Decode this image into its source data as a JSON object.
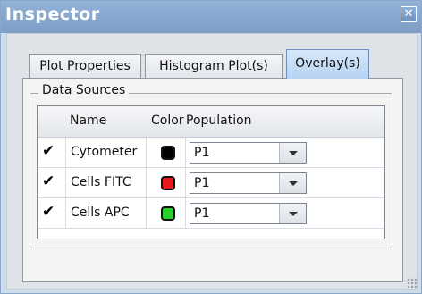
{
  "window": {
    "title": "Inspector",
    "close_symbol": "✕"
  },
  "tabs": [
    {
      "label": "Plot Properties",
      "active": false
    },
    {
      "label": "Histogram Plot(s)",
      "active": false
    },
    {
      "label": "Overlay(s)",
      "active": true
    }
  ],
  "data_sources": {
    "group_label": "Data Sources",
    "columns": {
      "check": "",
      "name": "Name",
      "color": "Color",
      "population": "Population"
    },
    "rows": [
      {
        "checked": true,
        "check_symbol": "✔",
        "name": "Cytometer",
        "color": "#000000",
        "population": "P1"
      },
      {
        "checked": true,
        "check_symbol": "✔",
        "name": "Cells FITC",
        "color": "#e8191c",
        "population": "P1"
      },
      {
        "checked": true,
        "check_symbol": "✔",
        "name": "Cells APC",
        "color": "#25d12a",
        "population": "P1"
      }
    ]
  },
  "icons": {
    "close": "close-icon",
    "dropdown": "chevron-down-icon",
    "check": "check-icon",
    "grip": "resize-grip-icon"
  }
}
